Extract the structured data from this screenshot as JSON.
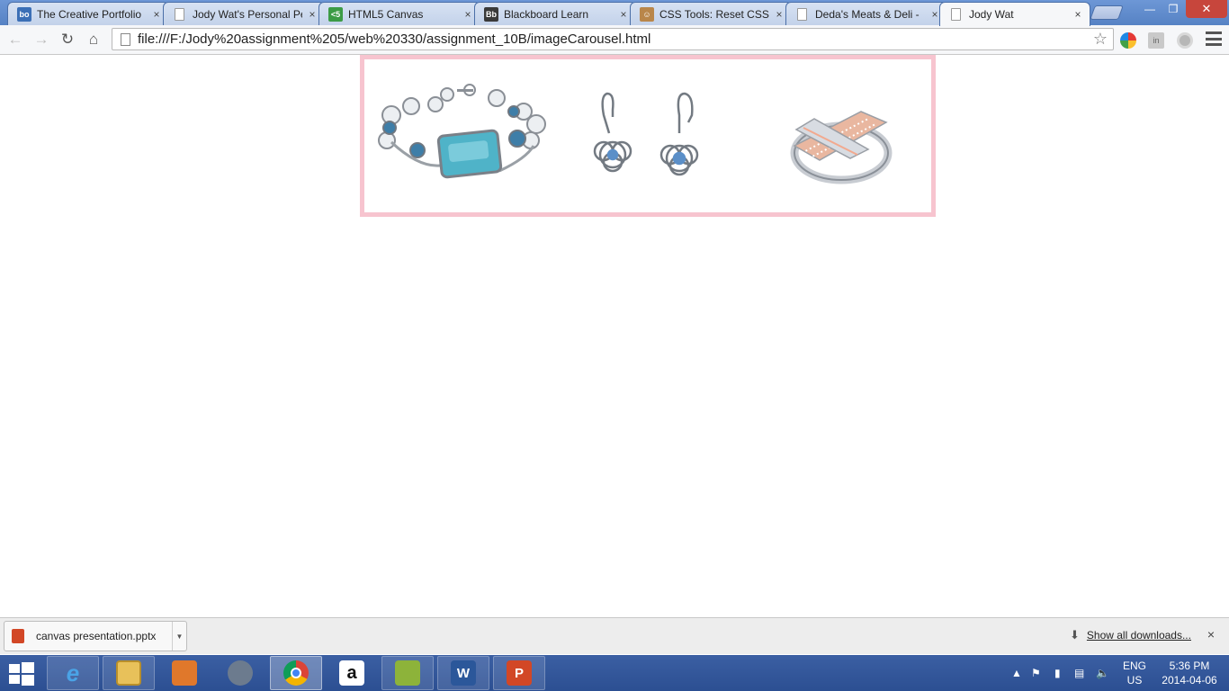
{
  "browser": {
    "tabs": [
      {
        "title": "The Creative Portfolio",
        "favicon": "bo-icon",
        "active": false
      },
      {
        "title": "Jody Wat's Personal Pe",
        "favicon": "document-icon",
        "active": false
      },
      {
        "title": "HTML5 Canvas",
        "favicon": "html5-icon",
        "active": false
      },
      {
        "title": "Blackboard Learn",
        "favicon": "blackboard-icon",
        "active": false
      },
      {
        "title": "CSS Tools: Reset CSS",
        "favicon": "css-tools-icon",
        "active": false
      },
      {
        "title": "Deda's Meats & Deli -",
        "favicon": "document-icon",
        "active": false
      },
      {
        "title": "Jody Wat",
        "favicon": "document-icon",
        "active": true
      }
    ],
    "tab_close_glyph": "×",
    "address_bar": {
      "url": "file:///F:/Jody%20assignment%205/web%20330/assignment_10B/imageCarousel.html"
    },
    "window_controls": {
      "minimize": "—",
      "maximize": "❐",
      "close": "✕"
    }
  },
  "page": {
    "carousel": {
      "border_color": "#f7c4cf",
      "images": [
        "bracelet-image",
        "earrings-image",
        "ring-image"
      ]
    }
  },
  "downloads": {
    "file_name": "canvas presentation.pptx",
    "show_all_label": "Show all downloads...",
    "close_glyph": "×"
  },
  "taskbar": {
    "apps": [
      "internet-explorer-icon",
      "file-explorer-icon",
      "photo-app-icon",
      "media-app-icon",
      "chrome-icon",
      "amazon-icon",
      "project-app-icon",
      "word-icon",
      "powerpoint-icon"
    ],
    "language": {
      "line1": "ENG",
      "line2": "US"
    },
    "clock": {
      "time": "5:36 PM",
      "date": "2014-04-06"
    }
  },
  "colors": {
    "titlebar": "#5682c4",
    "taskbar": "#2c4f92",
    "carousel_border": "#f7c4cf"
  }
}
